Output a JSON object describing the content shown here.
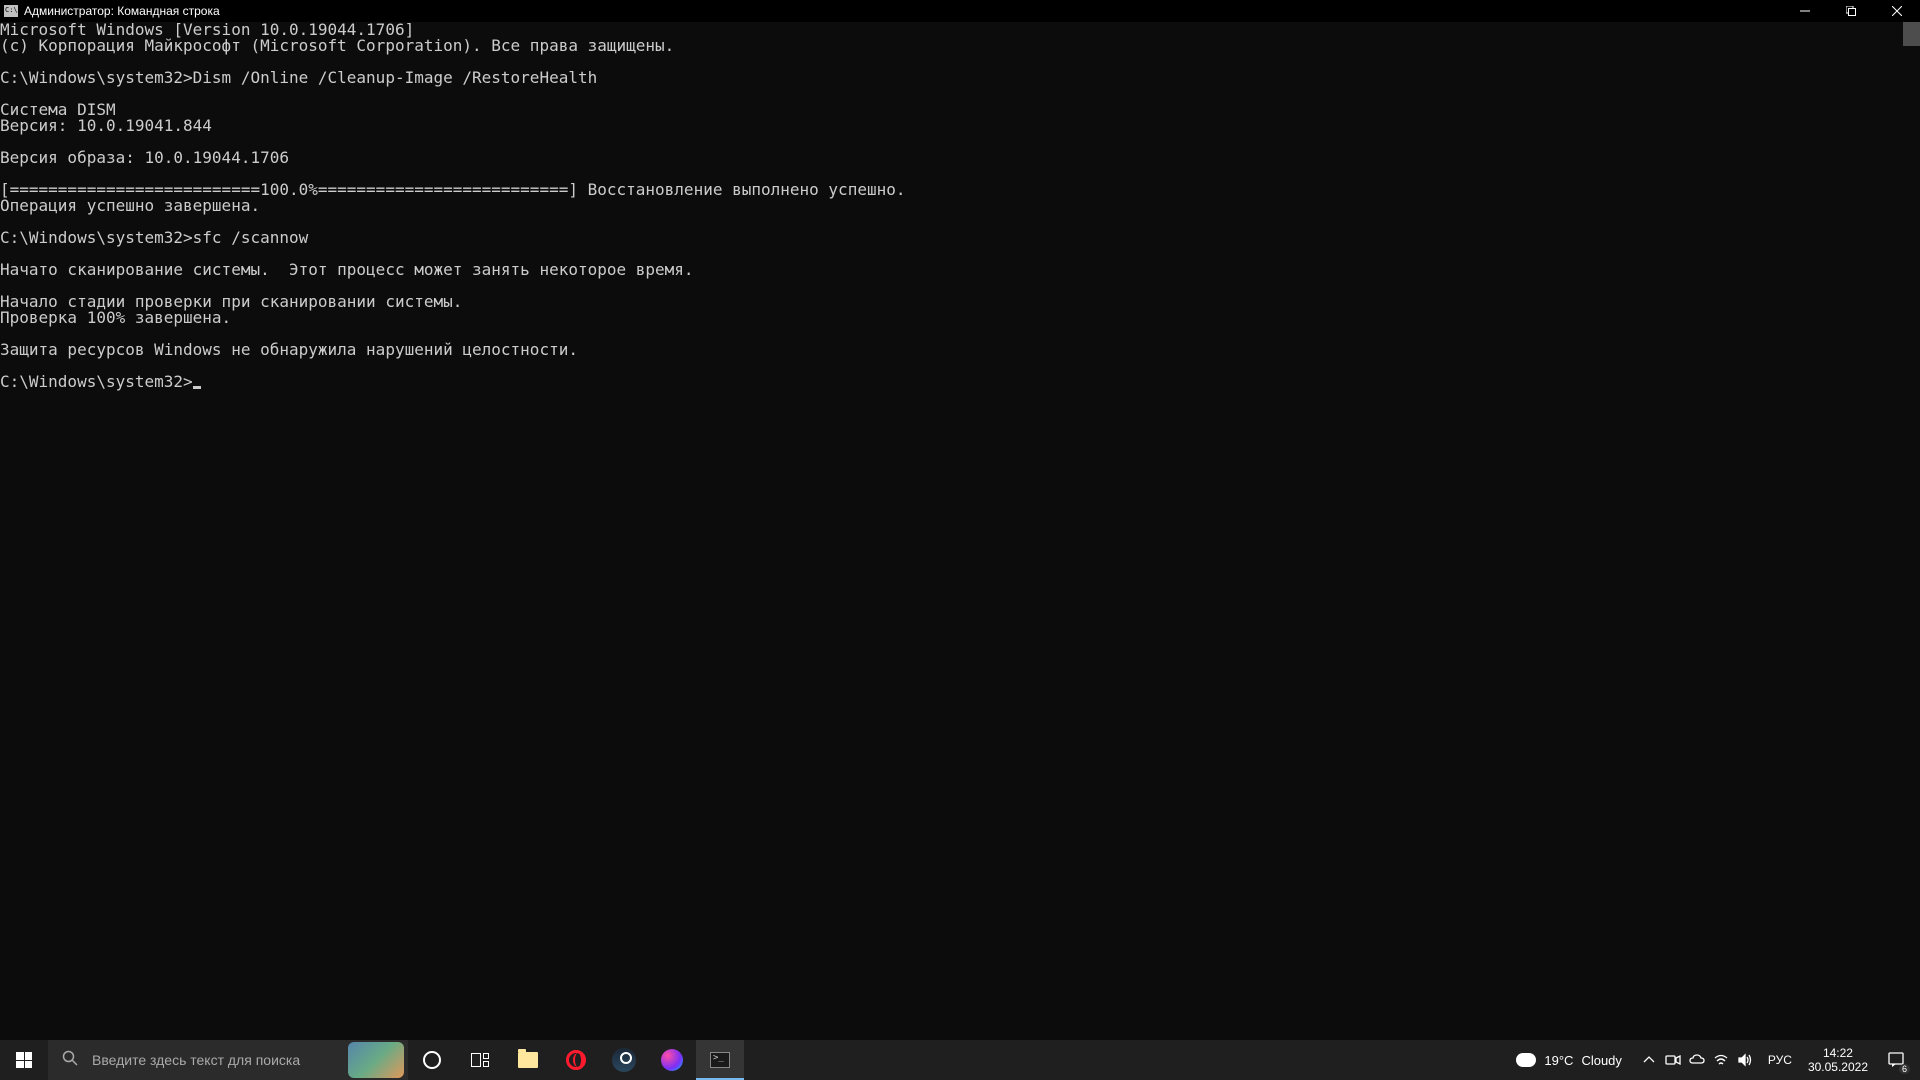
{
  "window": {
    "title": "Администратор: Командная строка"
  },
  "terminal": {
    "lines": [
      "Microsoft Windows [Version 10.0.19044.1706]",
      "(c) Корпорация Майкрософт (Microsoft Corporation). Все права защищены.",
      "",
      "C:\\Windows\\system32>Dism /Online /Cleanup-Image /RestoreHealth",
      "",
      "Cистема DISM",
      "Версия: 10.0.19041.844",
      "",
      "Версия образа: 10.0.19044.1706",
      "",
      "[==========================100.0%==========================] Восстановление выполнено успешно.",
      "Операция успешно завершена.",
      "",
      "C:\\Windows\\system32>sfc /scannow",
      "",
      "Начато сканирование системы.  Этот процесс может занять некоторое время.",
      "",
      "Начало стадии проверки при сканировании системы.",
      "Проверка 100% завершена.",
      "",
      "Защита ресурсов Windows не обнаружила нарушений целостности.",
      ""
    ],
    "prompt": "C:\\Windows\\system32>"
  },
  "taskbar": {
    "search_placeholder": "Введите здесь текст для поиска",
    "weather_temp": "19°C",
    "weather_cond": "Cloudy",
    "lang": "РУС",
    "time": "14:22",
    "date": "30.05.2022",
    "notif_count": "6"
  }
}
